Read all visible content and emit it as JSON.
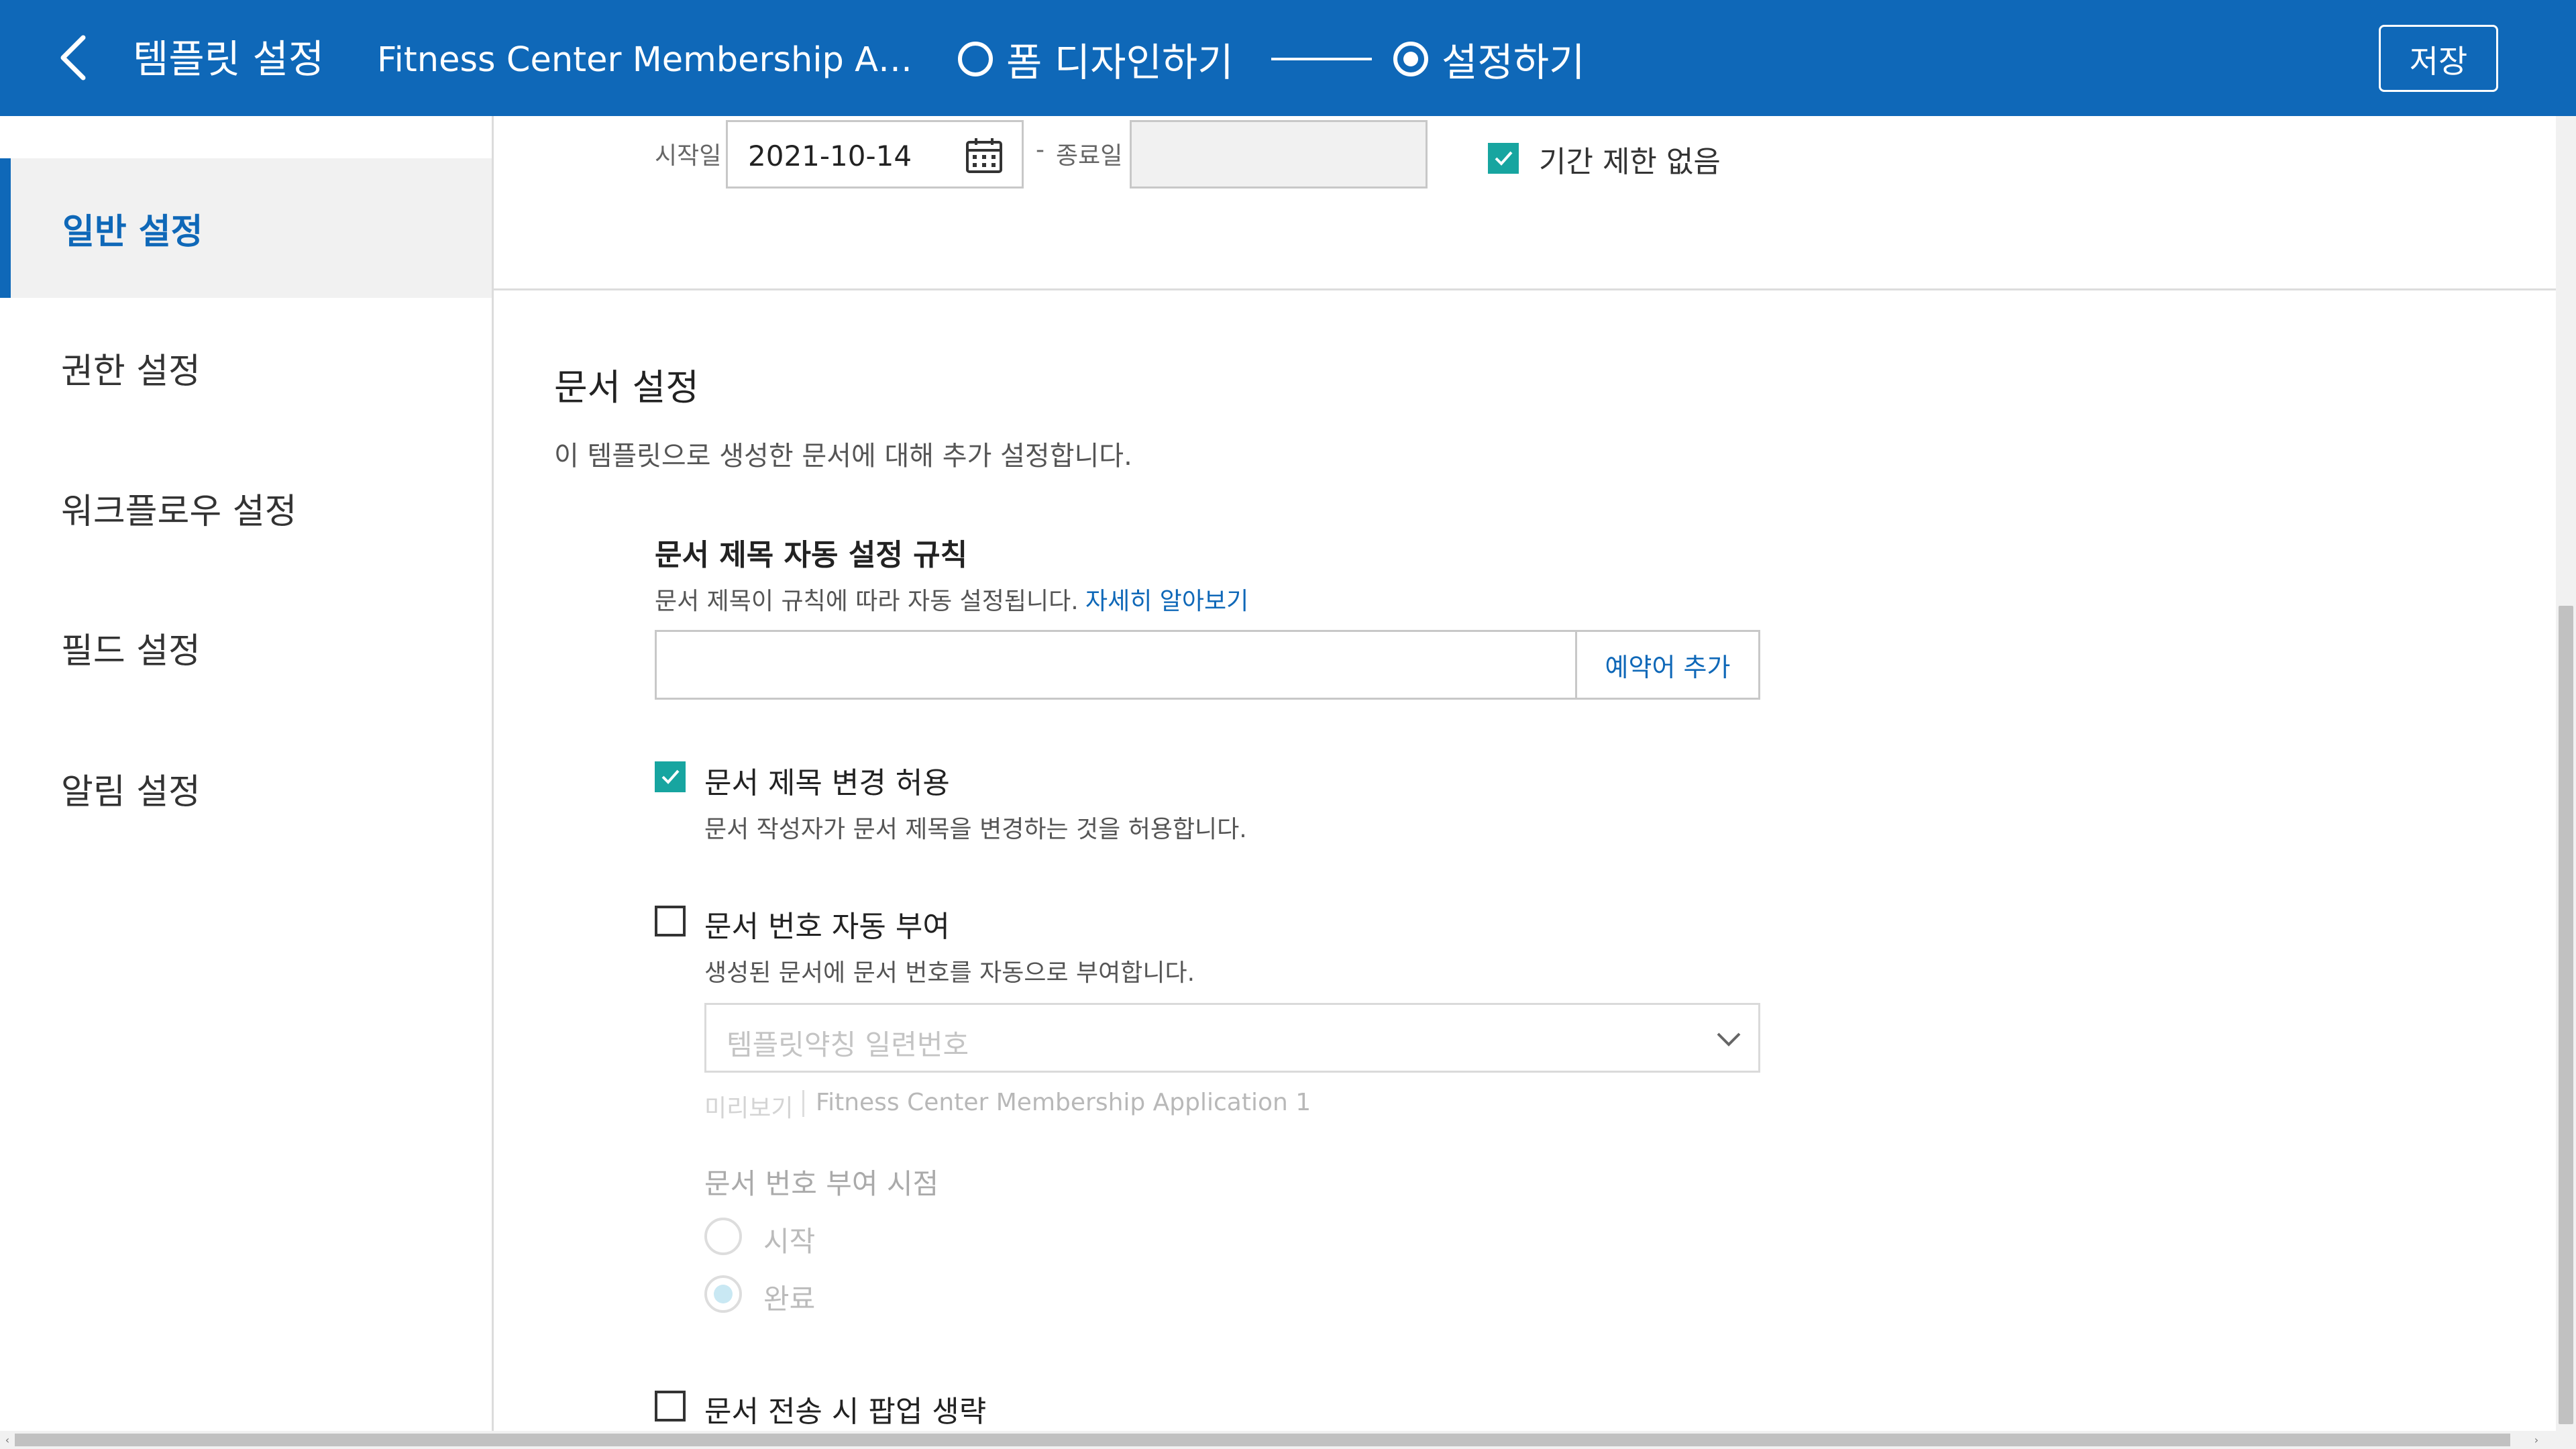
{
  "header": {
    "title": "템플릿 설정",
    "doc_name": "Fitness Center Membership Appli…",
    "steps": [
      {
        "label": "폼 디자인하기",
        "selected": false
      },
      {
        "label": "설정하기",
        "selected": true
      }
    ],
    "save_label": "저장"
  },
  "sidebar": {
    "items": [
      {
        "label": "일반 설정",
        "active": true
      },
      {
        "label": "권한 설정",
        "active": false
      },
      {
        "label": "워크플로우 설정",
        "active": false
      },
      {
        "label": "필드 설정",
        "active": false
      },
      {
        "label": "알림 설정",
        "active": false
      }
    ]
  },
  "period": {
    "start_label": "시작일",
    "start_value": "2021-10-14",
    "separator": "-",
    "end_label": "종료일",
    "end_value": "",
    "unlimited_label": "기간 제한 없음",
    "unlimited_checked": true
  },
  "doc_settings": {
    "title": "문서 설정",
    "description": "이 템플릿으로 생성한 문서에 대해 추가 설정합니다.",
    "auto_title": {
      "label": "문서 제목 자동 설정 규칙",
      "help": "문서 제목이 규칙에 따라 자동 설정됩니다.",
      "learn_more": "자세히 알아보기",
      "value": "",
      "add_reserved_word": "예약어 추가"
    },
    "allow_title_change": {
      "label": "문서 제목 변경 허용",
      "help": "문서 작성자가 문서 제목을 변경하는 것을 허용합니다.",
      "checked": true
    },
    "auto_number": {
      "label": "문서 번호 자동 부여",
      "help": "생성된 문서에 문서 번호를 자동으로 부여합니다.",
      "checked": false,
      "select_value": "템플릿약칭 일련번호",
      "preview_label": "미리보기",
      "preview_value": "Fitness Center Membership Application 1",
      "timing_label": "문서 번호 부여 시점",
      "timing_options": [
        {
          "label": "시작",
          "selected": false
        },
        {
          "label": "완료",
          "selected": true
        }
      ]
    },
    "skip_popup": {
      "label": "문서 전송 시 팝업 생략",
      "checked": false
    }
  },
  "colors": {
    "header_bg": "#0f68b8",
    "accent": "#0f68b8",
    "check": "#17a5a0"
  }
}
